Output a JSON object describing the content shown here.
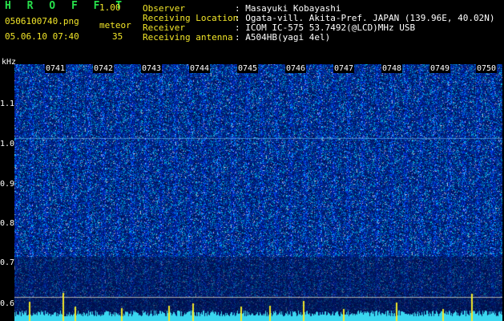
{
  "header": {
    "app_name": "H R O F F T",
    "app_version": "1.00",
    "filename": "0506100740.png",
    "meteor_label": "meteor",
    "meteor_count": "35",
    "datetime": "05.06.10 07:40",
    "info_labels": [
      "Observer",
      "Receiving Location",
      "Receiver",
      "Receiving antenna"
    ],
    "info_values": [
      ": Masayuki Kobayashi",
      ": Ogata-vill. Akita-Pref. JAPAN (139.96E, 40.02N)",
      ": ICOM IC-575 53.7492(@LCD)MHz USB",
      ": A504HB(yagi 4el)"
    ]
  },
  "axis": {
    "unit": "kHz",
    "y_ticks": [
      "1.1",
      "1.0",
      "0.9",
      "0.8",
      "0.7",
      "0.6"
    ],
    "time_ticks": [
      "0741",
      "0742",
      "0743",
      "0744",
      "0745",
      "0746",
      "0747",
      "0748",
      "0749",
      "0750"
    ]
  },
  "colors": {
    "background": "#000000",
    "spectrum_base": "#030a55",
    "spectrum_noise": "#2a6cff",
    "meteor_trace": "#f2e629",
    "baseline": "#3ad7f0",
    "title_green": "#27e04b"
  }
}
